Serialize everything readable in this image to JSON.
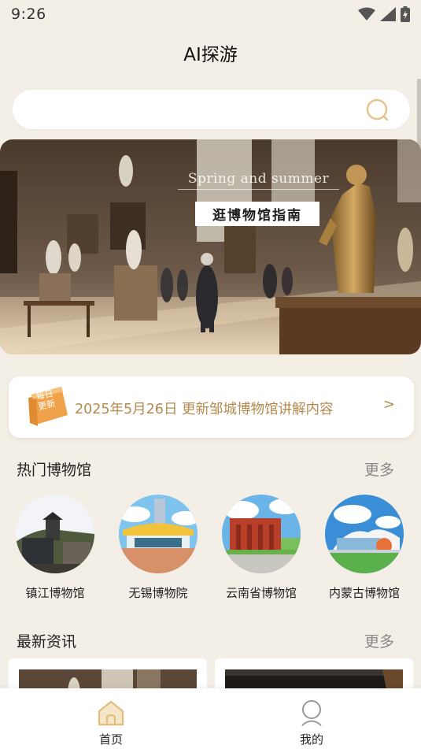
{
  "status_bar": {
    "time": "9:26"
  },
  "header": {
    "title": "AI探游"
  },
  "search": {
    "placeholder": ""
  },
  "banner": {
    "subtitle": "Spring and summer",
    "title": "逛博物馆指南"
  },
  "daily_update": {
    "badge_line1": "每日",
    "badge_line2": "更新",
    "text": "2025年5月26日 更新邹城博物馆讲解内容",
    "arrow": ">"
  },
  "popular": {
    "title": "热门博物馆",
    "more": "更多",
    "items": [
      {
        "name": "镇江博物馆"
      },
      {
        "name": "无锡博物院"
      },
      {
        "name": "云南省博物馆"
      },
      {
        "name": "内蒙古博物馆"
      }
    ]
  },
  "news": {
    "title": "最新资讯",
    "more": "更多"
  },
  "bottom_nav": {
    "home": "首页",
    "mine": "我的"
  },
  "colors": {
    "accent": "#b58a4e",
    "background": "#f4efe6",
    "badge": "#f0a24a"
  },
  "icons": [
    "wifi-icon",
    "signal-icon",
    "battery-icon",
    "search-icon",
    "home-icon",
    "user-icon"
  ]
}
